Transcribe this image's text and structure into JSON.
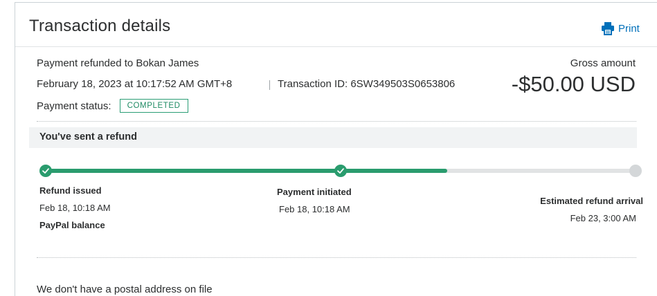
{
  "header": {
    "title": "Transaction details",
    "print_label": "Print"
  },
  "summary": {
    "headline": "Payment refunded to Bokan James",
    "datetime": "February 18, 2023 at 10:17:52 AM GMT+8",
    "transaction_id": "Transaction ID: 6SW349503S0653806",
    "status_label": "Payment status:",
    "status_value": "COMPLETED",
    "gross_label": "Gross amount",
    "gross_amount": "-$50.00 USD"
  },
  "refund": {
    "banner": "You've sent a refund",
    "progress_fraction": 0.68,
    "steps": [
      {
        "title": "Refund issued",
        "date": "Feb 18, 10:18 AM",
        "extra": "PayPal balance",
        "done": true
      },
      {
        "title": "Payment initiated",
        "date": "Feb 18, 10:18 AM",
        "done": true
      },
      {
        "title": "Estimated refund arrival",
        "date": "Feb 23, 3:00 AM",
        "done": false
      }
    ]
  },
  "postal": {
    "message": "We don't have a postal address on file"
  },
  "colors": {
    "accent": "#0070ba",
    "success": "#2a9c6e",
    "track": "#e1e3e4"
  },
  "icons": {
    "print": "printer-icon",
    "check": "check-icon"
  }
}
